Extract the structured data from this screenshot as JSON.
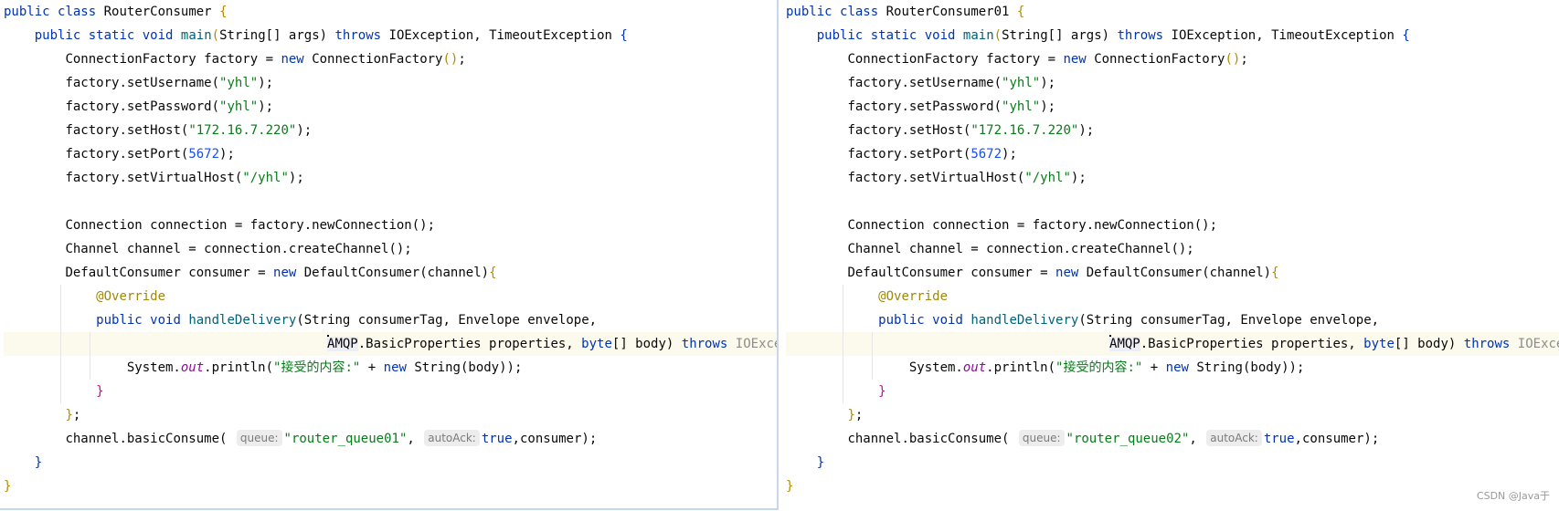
{
  "left": {
    "class_name": "RouterConsumer",
    "queue_value": "\"router_queue01\""
  },
  "right": {
    "class_name": "RouterConsumer01",
    "queue_value": "\"router_queue02\""
  },
  "code": {
    "kw_public": "public",
    "kw_class": "class",
    "kw_static": "static",
    "kw_void": "void",
    "kw_throws": "throws",
    "kw_new": "new",
    "kw_byte": "byte",
    "kw_true": "true",
    "main_name": "main",
    "main_params": "String[] args) ",
    "exceptions": "IOException, TimeoutException ",
    "cf_decl": "ConnectionFactory factory = ",
    "cf_ctor": "ConnectionFactory",
    "set_username": "factory.setUsername",
    "set_password": "factory.setPassword",
    "set_host": "factory.setHost",
    "set_port": "factory.setPort",
    "set_vhost": "factory.setVirtualHost",
    "str_user": "\"yhl\"",
    "str_pass": "\"yhl\"",
    "str_host": "\"172.16.7.220\"",
    "port": "5672",
    "str_vhost": "\"/yhl\"",
    "conn_decl": "Connection connection = factory.newConnection",
    "chan_decl": "Channel channel = connection.createChannel",
    "consumer_decl": "DefaultConsumer consumer = ",
    "consumer_ctor": "DefaultConsumer",
    "consumer_arg": "channel",
    "override": "@Override",
    "handle_name": "handleDelivery",
    "handle_params1": "String consumerTag, Envelope envelope,",
    "amqp_prefix": "AMQP",
    "handle_params2": ".BasicProperties properties, ",
    "body_param": "[] body",
    "io_exception": "IOException",
    "sysout_a": "System.",
    "sysout_out": "out",
    "sysout_b": ".println",
    "str_content": "\"接受的内容:\"",
    "plus": " + ",
    "string_body": "String",
    "body_arg": "body",
    "basic_consume": "channel.basicConsume",
    "hint_queue": "queue:",
    "hint_autoack": "autoAck:",
    "consumer_ref": ",consumer"
  },
  "watermark": "CSDN @Java于"
}
